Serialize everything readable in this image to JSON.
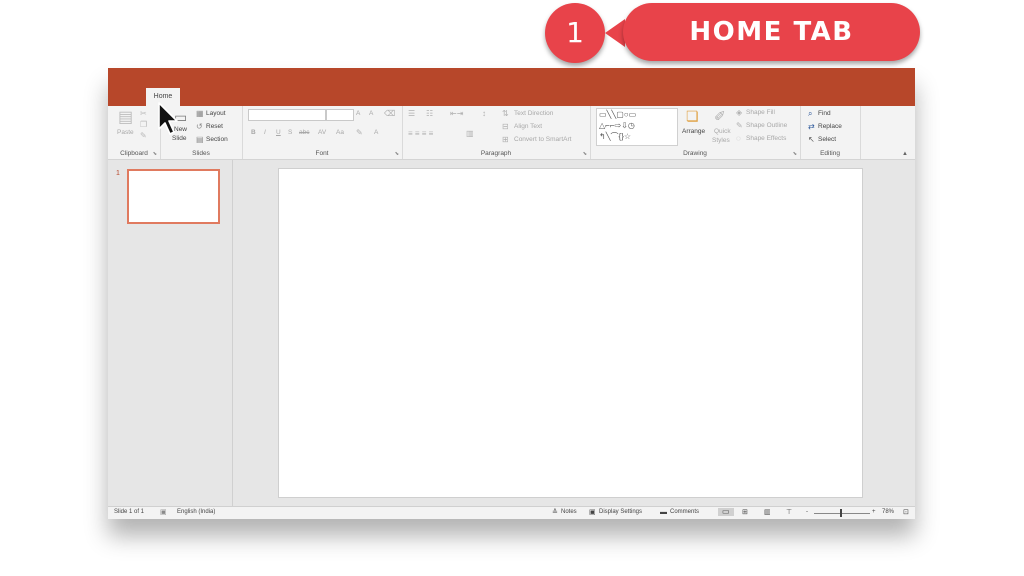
{
  "callout": {
    "number": "1",
    "label": "HOME TAB"
  },
  "tabs": {
    "home": "Home"
  },
  "ribbon": {
    "clipboard": {
      "paste": "Paste",
      "label": "Clipboard"
    },
    "slides": {
      "new": "New",
      "new2": "Slide",
      "layout": "Layout",
      "reset": "Reset",
      "section": "Section",
      "label": "Slides"
    },
    "font": {
      "label": "Font",
      "bold": "B",
      "italic": "I",
      "underline": "U",
      "shadow": "S",
      "strike": "abc",
      "spacing": "AV",
      "case": "Aa",
      "color": "A",
      "grow": "A",
      "shrink": "A"
    },
    "paragraph": {
      "text_direction": "Text Direction",
      "align_text": "Align Text",
      "convert_smartart": "Convert to SmartArt",
      "label": "Paragraph"
    },
    "drawing": {
      "arrange": "Arrange",
      "quick": "Quick",
      "styles": "Styles",
      "shape_fill": "Shape Fill",
      "shape_outline": "Shape Outline",
      "shape_effects": "Shape Effects",
      "label": "Drawing"
    },
    "editing": {
      "find": "Find",
      "replace": "Replace",
      "select": "Select",
      "label": "Editing"
    }
  },
  "slides_pane": {
    "thumb_number": "1"
  },
  "status": {
    "slide_count": "Slide 1 of 1",
    "language": "English (India)",
    "notes": "Notes",
    "display_settings": "Display Settings",
    "comments": "Comments",
    "zoom": "78%",
    "zoom_minus": "-",
    "zoom_plus": "+"
  }
}
